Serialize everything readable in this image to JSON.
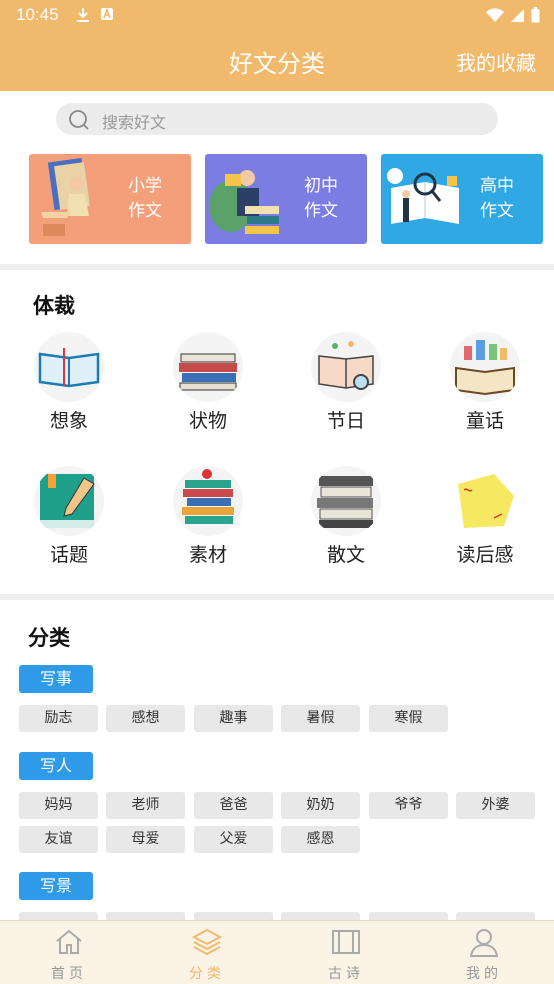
{
  "status_bar": {
    "time": "10:45"
  },
  "header": {
    "title": "好文分类",
    "favorites": "我的收藏"
  },
  "search": {
    "placeholder": "搜索好文"
  },
  "levels": [
    {
      "label": "小学\n作文",
      "color": "#f3a07a"
    },
    {
      "label": "初中\n作文",
      "color": "#7c7de3"
    },
    {
      "label": "高中\n作文",
      "color": "#2fa8e4"
    }
  ],
  "genre": {
    "title": "体裁",
    "items": [
      {
        "label": "想象",
        "icon": "open-book-icon"
      },
      {
        "label": "状物",
        "icon": "book-stack-icon"
      },
      {
        "label": "节日",
        "icon": "magnifier-book-icon"
      },
      {
        "label": "童话",
        "icon": "fairy-book-icon"
      },
      {
        "label": "话题",
        "icon": "green-book-pencil-icon"
      },
      {
        "label": "素材",
        "icon": "tall-book-stack-icon"
      },
      {
        "label": "散文",
        "icon": "grey-book-stack-icon"
      },
      {
        "label": "读后感",
        "icon": "reading-note-icon"
      }
    ]
  },
  "category": {
    "title": "分类",
    "groups": [
      {
        "name": "写事",
        "tags": [
          "励志",
          "感想",
          "趣事",
          "暑假",
          "寒假"
        ]
      },
      {
        "name": "写人",
        "tags": [
          "妈妈",
          "老师",
          "爸爸",
          "奶奶",
          "爷爷",
          "外婆",
          "友谊",
          "母爱",
          "父爱",
          "感恩"
        ]
      },
      {
        "name": "写景",
        "tags": [
          "",
          "",
          "",
          "",
          "",
          ""
        ]
      }
    ]
  },
  "tabs": [
    {
      "label": "首页",
      "icon": "home-icon",
      "active": false
    },
    {
      "label": "分类",
      "icon": "layers-icon",
      "active": true
    },
    {
      "label": "古诗",
      "icon": "scroll-icon",
      "active": false
    },
    {
      "label": "我的",
      "icon": "user-icon",
      "active": false
    }
  ],
  "colors": {
    "accent": "#f0b96b",
    "chip_blue": "#2f9ae8"
  }
}
